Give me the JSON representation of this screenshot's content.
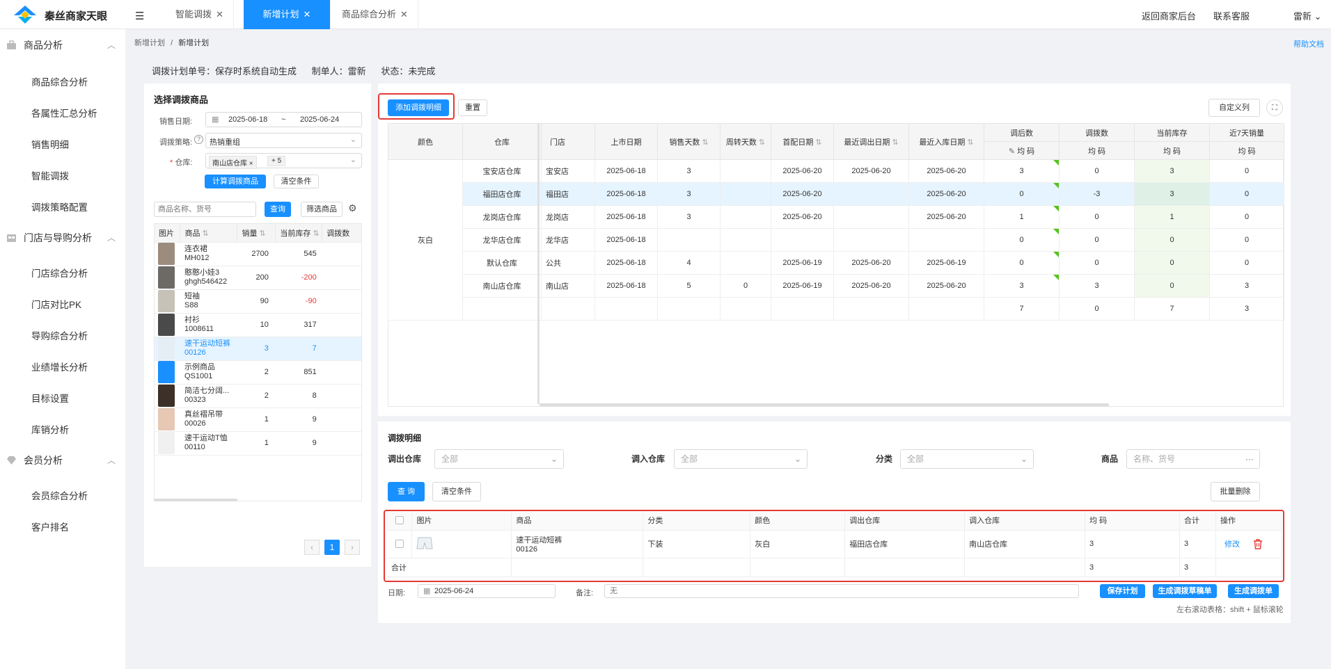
{
  "app": {
    "name": "秦丝商家天眼"
  },
  "tabs": [
    {
      "label": "智能调拨",
      "close": "✕"
    },
    {
      "label": "新增计划",
      "close": "✕"
    },
    {
      "label": "商品综合分析",
      "close": "✕"
    }
  ],
  "topnav": {
    "back": "返回商家后台",
    "support": "联系客服",
    "user": "雷新 ⌄"
  },
  "sidebar": {
    "groups": [
      {
        "label": "商品分析",
        "items": [
          "商品综合分析",
          "各属性汇总分析",
          "销售明细",
          "智能调拨",
          "调拨策略配置"
        ]
      },
      {
        "label": "门店与导购分析",
        "items": [
          "门店综合分析",
          "门店对比PK",
          "导购综合分析",
          "业绩增长分析",
          "目标设置",
          "库销分析"
        ]
      },
      {
        "label": "会员分析",
        "items": [
          "会员综合分析",
          "客户排名"
        ]
      }
    ]
  },
  "breadcrumb": {
    "parent": "新增计划",
    "sep": "/",
    "current": "新增计划"
  },
  "help": "帮助文档",
  "planinfo": {
    "no_label": "调拨计划单号：",
    "no_value": "保存时系统自动生成",
    "maker_label": "制单人：",
    "maker_value": "雷新",
    "status_label": "状态：",
    "status_value": "未完成"
  },
  "leftpanel": {
    "title": "选择调拨商品",
    "date_label": "销售日期:",
    "date_start": "2025-06-18",
    "date_tilde": "~",
    "date_end": "2025-06-24",
    "strategy_label": "调拨策略:",
    "strategy_help": "?",
    "strategy_value": "热销重组",
    "warehouse_label": "仓库:",
    "warehouse_required": "*",
    "warehouse_tag": "南山店仓库",
    "warehouse_more": "+ 5",
    "calc_button": "计算调拨商品",
    "clear_button": "清空条件",
    "search_placeholder": "商品名称、货号",
    "search_button": "查询",
    "filter_button": "筛选商品",
    "columns": [
      "图片",
      "商品",
      "销量",
      "当前库存",
      "调拨数"
    ],
    "rows": [
      {
        "name": "连衣裙",
        "code": "MH012",
        "sales": "2700",
        "stock": "545",
        "neg": false,
        "selected": false
      },
      {
        "name": "憨憨小娃3",
        "code": "ghgh546422",
        "sales": "200",
        "stock": "-200",
        "neg": true,
        "selected": false
      },
      {
        "name": "短袖",
        "code": "S88",
        "sales": "90",
        "stock": "-90",
        "neg": true,
        "selected": false
      },
      {
        "name": "衬衫",
        "code": "1008611",
        "sales": "10",
        "stock": "317",
        "neg": false,
        "selected": false
      },
      {
        "name": "速干运动短裤",
        "code": "00126",
        "sales": "3",
        "stock": "7",
        "neg": false,
        "selected": true
      },
      {
        "name": "示例商品",
        "code": "QS1001",
        "sales": "2",
        "stock": "851",
        "neg": false,
        "selected": false
      },
      {
        "name": "简洁七分阔...",
        "code": "00323",
        "sales": "2",
        "stock": "8",
        "neg": false,
        "selected": false
      },
      {
        "name": "真丝褶吊带",
        "code": "00026",
        "sales": "1",
        "stock": "9",
        "neg": false,
        "selected": false
      },
      {
        "name": "速干运动T恤",
        "code": "00110",
        "sales": "1",
        "stock": "9",
        "neg": false,
        "selected": false
      }
    ],
    "pager": {
      "prev": "‹",
      "page": "1",
      "next": "›"
    }
  },
  "grid": {
    "add_button": "添加调拨明细",
    "reset_button": "重置",
    "custom_button": "自定义列",
    "columns": [
      "颜色",
      "仓库",
      "门店",
      "上市日期",
      "销售天数",
      "周转天数",
      "首配日期",
      "最近调出日期",
      "最近入库日期",
      "调后数",
      "调拨数",
      "当前库存",
      "近7天销量"
    ],
    "subcolumns": [
      "均 码",
      "均 码",
      "均 码",
      "均 码"
    ],
    "edit_icon": "✎",
    "color_value": "灰白",
    "rows": [
      {
        "wh": "宝安店仓库",
        "store": "宝安店",
        "date": "2025-06-18",
        "sdays": "3",
        "tdays": "",
        "first": "2025-06-20",
        "out": "2025-06-20",
        "in": "2025-06-20",
        "after": "3",
        "move": "0",
        "stock": "3",
        "s7": "0"
      },
      {
        "wh": "福田店仓库",
        "store": "福田店",
        "date": "2025-06-18",
        "sdays": "3",
        "tdays": "",
        "first": "2025-06-20",
        "out": "",
        "in": "2025-06-20",
        "after": "0",
        "move": "-3",
        "stock": "3",
        "s7": "0"
      },
      {
        "wh": "龙岗店仓库",
        "store": "龙岗店",
        "date": "2025-06-18",
        "sdays": "3",
        "tdays": "",
        "first": "2025-06-20",
        "out": "",
        "in": "2025-06-20",
        "after": "1",
        "move": "0",
        "stock": "1",
        "s7": "0"
      },
      {
        "wh": "龙华店仓库",
        "store": "龙华店",
        "date": "2025-06-18",
        "sdays": "",
        "tdays": "",
        "first": "",
        "out": "",
        "in": "",
        "after": "0",
        "move": "0",
        "stock": "0",
        "s7": "0"
      },
      {
        "wh": "默认仓库",
        "store": "公共",
        "date": "2025-06-18",
        "sdays": "4",
        "tdays": "",
        "first": "2025-06-19",
        "out": "2025-06-20",
        "in": "2025-06-19",
        "after": "0",
        "move": "0",
        "stock": "0",
        "s7": "0"
      },
      {
        "wh": "南山店仓库",
        "store": "南山店",
        "date": "2025-06-18",
        "sdays": "5",
        "tdays": "0",
        "first": "2025-06-19",
        "out": "2025-06-20",
        "in": "2025-06-20",
        "after": "3",
        "move": "3",
        "stock": "0",
        "s7": "3"
      }
    ],
    "totals": {
      "after": "7",
      "move": "0",
      "stock": "7",
      "s7": "3"
    }
  },
  "detail": {
    "title": "调拨明细",
    "out_label": "调出仓库",
    "out_value": "全部",
    "in_label": "调入仓库",
    "in_value": "全部",
    "cat_label": "分类",
    "cat_value": "全部",
    "prod_label": "商品",
    "prod_placeholder": "名称、货号",
    "query_button": "查 询",
    "clear_button": "清空条件",
    "batch_delete": "批量删除",
    "columns": [
      "图片",
      "商品",
      "分类",
      "颜色",
      "调出仓库",
      "调入仓库",
      "均 码",
      "合计",
      "操作"
    ],
    "row": {
      "name": "速干运动短裤",
      "code": "00126",
      "category": "下装",
      "color": "灰白",
      "out": "福田店仓库",
      "in": "南山店仓库",
      "qty": "3",
      "total": "3",
      "edit": "修改"
    },
    "sum_label": "合计",
    "sum_qty": "3",
    "sum_total": "3",
    "date_label": "日期:",
    "date_value": "2025-06-24",
    "note_label": "备注:",
    "note_placeholder": "无",
    "save_button": "保存计划",
    "draft_button": "生成调拨草稿单",
    "create_button": "生成调拨单",
    "hint": "左右滚动表格：shift + 鼠标滚轮"
  },
  "colors": {
    "primary": "#1890ff",
    "danger": "#e53935",
    "green": "#52c41a",
    "selectedRow": "#e6f4ff"
  }
}
